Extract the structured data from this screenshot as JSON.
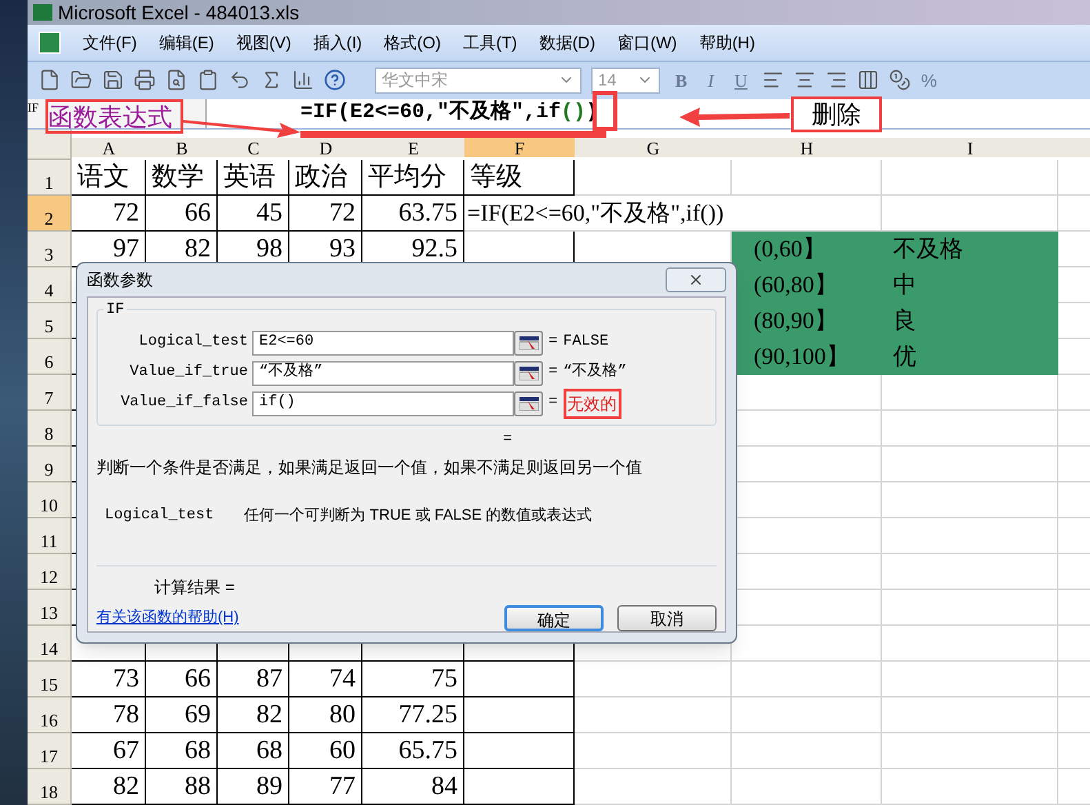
{
  "window": {
    "title": "Microsoft Excel - 484013.xls"
  },
  "menu": [
    {
      "label": "文件(F)"
    },
    {
      "label": "编辑(E)"
    },
    {
      "label": "视图(V)"
    },
    {
      "label": "插入(I)"
    },
    {
      "label": "格式(O)"
    },
    {
      "label": "工具(T)"
    },
    {
      "label": "数据(D)"
    },
    {
      "label": "窗口(W)"
    },
    {
      "label": "帮助(H)"
    }
  ],
  "toolbar": {
    "font": "华文中宋",
    "size": "14",
    "bold": "B",
    "italic": "I",
    "underline": "U",
    "percent": "%"
  },
  "formula_bar": {
    "name_box": "IF",
    "formula_parts": [
      {
        "text": "=IF(E2<=60,\"不及格\",if",
        "color": "#000000"
      },
      {
        "text": "()",
        "color": "#1f7a1f"
      },
      {
        "text": ")",
        "color": "#000000"
      }
    ]
  },
  "columns": [
    {
      "label": "A",
      "selected": false
    },
    {
      "label": "B",
      "selected": false
    },
    {
      "label": "C",
      "selected": false
    },
    {
      "label": "D",
      "selected": false
    },
    {
      "label": "E",
      "selected": false
    },
    {
      "label": "F",
      "selected": true
    },
    {
      "label": "G",
      "selected": false
    },
    {
      "label": "H",
      "selected": false
    },
    {
      "label": "I",
      "selected": false
    }
  ],
  "rows": [
    {
      "number": "1",
      "selected": false,
      "kind": "header",
      "cells": [
        "语文",
        "数学",
        "英语",
        "政治",
        "平均分",
        "等级"
      ]
    },
    {
      "number": "2",
      "selected": true,
      "kind": "data",
      "cells": [
        "72",
        "66",
        "45",
        "72",
        "63.75"
      ],
      "formula": "=IF(E2<=60,\"不及格\",if())"
    },
    {
      "number": "3",
      "selected": false,
      "kind": "data",
      "cells": [
        "97",
        "82",
        "98",
        "93",
        "92.5"
      ],
      "legend": {
        "range": "(0,60】",
        "grade": "不及格"
      }
    },
    {
      "number": "4",
      "selected": false,
      "kind": "data",
      "legend": {
        "range": "(60,80】",
        "grade": "中"
      }
    },
    {
      "number": "5",
      "selected": false,
      "kind": "data",
      "legend": {
        "range": "(80,90】",
        "grade": "良"
      }
    },
    {
      "number": "6",
      "selected": false,
      "kind": "data",
      "legend": {
        "range": "(90,100】",
        "grade": "优"
      }
    },
    {
      "number": "7",
      "selected": false,
      "kind": "data"
    },
    {
      "number": "8",
      "selected": false,
      "kind": "data"
    },
    {
      "number": "9",
      "selected": false,
      "kind": "data"
    },
    {
      "number": "10",
      "selected": false,
      "kind": "data"
    },
    {
      "number": "11",
      "selected": false,
      "kind": "data"
    },
    {
      "number": "12",
      "selected": false,
      "kind": "data"
    },
    {
      "number": "13",
      "selected": false,
      "kind": "data"
    },
    {
      "number": "14",
      "selected": false,
      "kind": "data"
    },
    {
      "number": "15",
      "selected": false,
      "kind": "data",
      "cells": [
        "73",
        "66",
        "87",
        "74",
        "75"
      ]
    },
    {
      "number": "16",
      "selected": false,
      "kind": "data",
      "cells": [
        "78",
        "69",
        "82",
        "80",
        "77.25"
      ]
    },
    {
      "number": "17",
      "selected": false,
      "kind": "data",
      "cells": [
        "67",
        "68",
        "68",
        "60",
        "65.75"
      ]
    },
    {
      "number": "18",
      "selected": false,
      "kind": "data",
      "cells": [
        "82",
        "88",
        "89",
        "77",
        "84"
      ]
    }
  ],
  "dialog": {
    "title": "函数参数",
    "function": "IF",
    "arguments": [
      {
        "label": "Logical_test",
        "value": "E2<=60",
        "equals": "=",
        "result": "FALSE",
        "invalid": false
      },
      {
        "label": "Value_if_true",
        "value": "“不及格”",
        "equals": "=",
        "result": "“不及格”",
        "invalid": false
      },
      {
        "label": "Value_if_false",
        "value": "if()",
        "equals": "=",
        "result": "无效的",
        "invalid": true
      }
    ],
    "formula_result": "=",
    "description": "判断一个条件是否满足，如果满足返回一个值，如果不满足则返回另一个值",
    "argument_help": {
      "name": "Logical_test",
      "text": "任何一个可判断为 TRUE 或 FALSE 的数值或表达式"
    },
    "calc_result": "计算结果 =",
    "help_link": "有关该函数的帮助(H)",
    "buttons": [
      {
        "label": "确定",
        "default": true
      },
      {
        "label": "取消",
        "default": false
      }
    ]
  },
  "annotations": {
    "expression_label": "函数表达式",
    "delete_label": "删除"
  }
}
